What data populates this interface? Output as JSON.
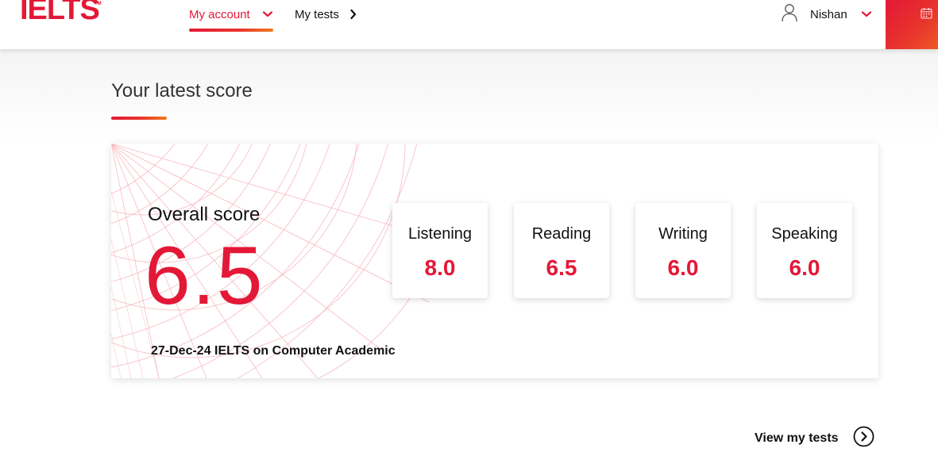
{
  "header": {
    "logo_text": "IELTS",
    "logo_tm": "TM",
    "nav": [
      {
        "label": "My account",
        "active": true
      },
      {
        "label": "My tests",
        "active": false
      }
    ],
    "user": {
      "name": "Nishan"
    },
    "icons": {
      "account_chevron": "chevron-down-icon",
      "tests_chevron": "chevron-right-icon",
      "user": "user-icon",
      "calendar": "calendar-icon"
    }
  },
  "main": {
    "section_title": "Your latest score",
    "score_card": {
      "overall_label": "Overall score",
      "overall_score": "6.5",
      "test_info": "27-Dec-24 IELTS on Computer Academic",
      "bands": [
        {
          "name": "Listening",
          "score": "8.0"
        },
        {
          "name": "Reading",
          "score": "6.5"
        },
        {
          "name": "Writing",
          "score": "6.0"
        },
        {
          "name": "Speaking",
          "score": "6.0"
        }
      ]
    },
    "view_tests_label": "View my tests"
  },
  "colors": {
    "brand_red": "#e31837",
    "brand_orange": "#f07a1e",
    "text_dark": "#111111"
  }
}
